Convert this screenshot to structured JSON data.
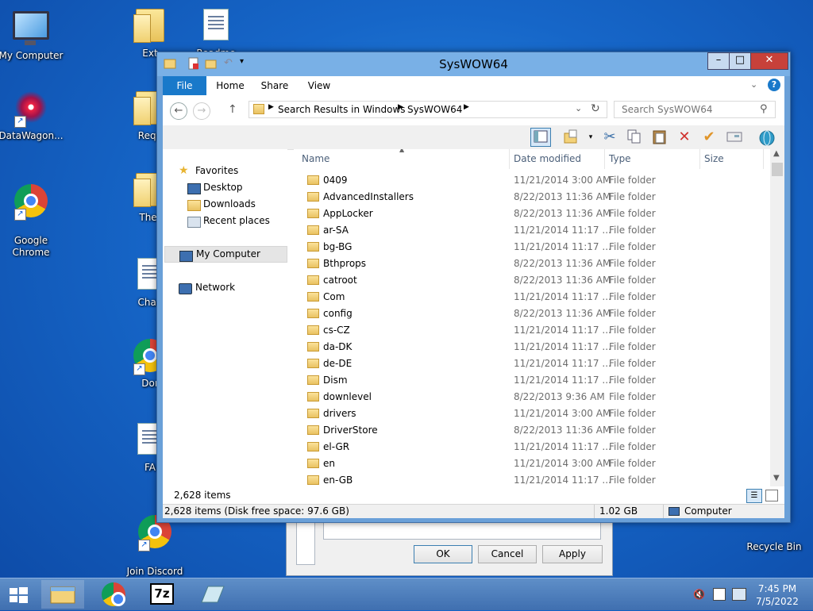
{
  "desktop": {
    "icons": [
      {
        "label": "My Computer"
      },
      {
        "label": "DataWagon..."
      },
      {
        "label": "Google\nChrome"
      },
      {
        "label": "Ext"
      },
      {
        "label": "Requ"
      },
      {
        "label": "Ther"
      },
      {
        "label": "Chan"
      },
      {
        "label": "Dor"
      },
      {
        "label": "FA"
      },
      {
        "label": "Join Discord\nServer"
      },
      {
        "label": "Recycle Bin"
      },
      {
        "label": "Readme"
      }
    ]
  },
  "background_dialog": {
    "ok_label": "OK",
    "cancel_label": "Cancel",
    "apply_label": "Apply"
  },
  "window": {
    "title": "SysWOW64",
    "ribbon_tabs": [
      "File",
      "Home",
      "Share",
      "View"
    ],
    "address": {
      "crumbs": [
        "Search Results in Windows",
        "SysWOW64"
      ]
    },
    "search_placeholder": "Search SysWOW64",
    "nav": {
      "favorites": "Favorites",
      "desktop": "Desktop",
      "downloads": "Downloads",
      "recent": "Recent places",
      "computer": "My Computer",
      "network": "Network"
    },
    "columns": {
      "name": "Name",
      "date": "Date modified",
      "type": "Type",
      "size": "Size"
    },
    "rows": [
      {
        "name": "0409",
        "date": "11/21/2014 3:00 AM",
        "type": "File folder"
      },
      {
        "name": "AdvancedInstallers",
        "date": "8/22/2013 11:36 AM",
        "type": "File folder"
      },
      {
        "name": "AppLocker",
        "date": "8/22/2013 11:36 AM",
        "type": "File folder"
      },
      {
        "name": "ar-SA",
        "date": "11/21/2014 11:17 ...",
        "type": "File folder"
      },
      {
        "name": "bg-BG",
        "date": "11/21/2014 11:17 ...",
        "type": "File folder"
      },
      {
        "name": "Bthprops",
        "date": "8/22/2013 11:36 AM",
        "type": "File folder"
      },
      {
        "name": "catroot",
        "date": "8/22/2013 11:36 AM",
        "type": "File folder"
      },
      {
        "name": "Com",
        "date": "11/21/2014 11:17 ...",
        "type": "File folder"
      },
      {
        "name": "config",
        "date": "8/22/2013 11:36 AM",
        "type": "File folder"
      },
      {
        "name": "cs-CZ",
        "date": "11/21/2014 11:17 ...",
        "type": "File folder"
      },
      {
        "name": "da-DK",
        "date": "11/21/2014 11:17 ...",
        "type": "File folder"
      },
      {
        "name": "de-DE",
        "date": "11/21/2014 11:17 ...",
        "type": "File folder"
      },
      {
        "name": "Dism",
        "date": "11/21/2014 11:17 ...",
        "type": "File folder"
      },
      {
        "name": "downlevel",
        "date": "8/22/2013 9:36 AM",
        "type": "File folder"
      },
      {
        "name": "drivers",
        "date": "11/21/2014 3:00 AM",
        "type": "File folder"
      },
      {
        "name": "DriverStore",
        "date": "8/22/2013 11:36 AM",
        "type": "File folder"
      },
      {
        "name": "el-GR",
        "date": "11/21/2014 11:17 ...",
        "type": "File folder"
      },
      {
        "name": "en",
        "date": "11/21/2014 3:00 AM",
        "type": "File folder"
      },
      {
        "name": "en-GB",
        "date": "11/21/2014 11:17 ...",
        "type": "File folder"
      }
    ],
    "item_count": "2,628 items",
    "status": {
      "left": "2,628 items (Disk free space: 97.6 GB)",
      "size": "1.02 GB",
      "location": "Computer"
    }
  },
  "taskbar": {
    "time": "7:45 PM",
    "date": "7/5/2022"
  }
}
